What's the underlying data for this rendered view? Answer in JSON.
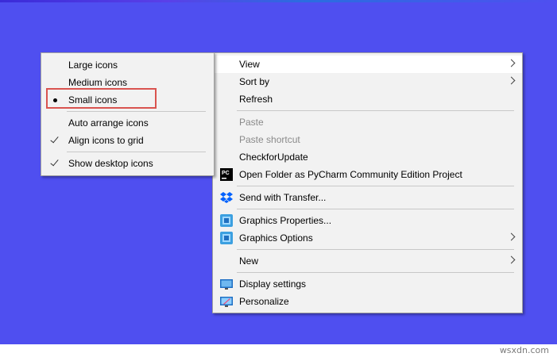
{
  "watermark": "wsxdn.com",
  "submenu": {
    "items": [
      {
        "label": "Large icons"
      },
      {
        "label": "Medium icons"
      },
      {
        "label": "Small icons"
      },
      {
        "label": "Auto arrange icons"
      },
      {
        "label": "Align icons to grid"
      },
      {
        "label": "Show desktop icons"
      }
    ]
  },
  "context_menu": {
    "items": [
      {
        "label": "View"
      },
      {
        "label": "Sort by"
      },
      {
        "label": "Refresh"
      },
      {
        "label": "Paste"
      },
      {
        "label": "Paste shortcut"
      },
      {
        "label": "CheckforUpdate"
      },
      {
        "label": "Open Folder as PyCharm Community Edition Project"
      },
      {
        "label": "Send with Transfer..."
      },
      {
        "label": "Graphics Properties..."
      },
      {
        "label": "Graphics Options"
      },
      {
        "label": "New"
      },
      {
        "label": "Display settings"
      },
      {
        "label": "Personalize"
      }
    ]
  },
  "colors": {
    "desktop": "#4f4ff0",
    "menu_bg": "#f2f2f2",
    "highlight_box": "#d9534f"
  },
  "icons": {
    "pycharm": "pycharm-icon",
    "dropbox": "dropbox-icon",
    "graphics": "intel-graphics-icon",
    "display": "display-settings-icon",
    "personalize": "personalize-icon"
  }
}
